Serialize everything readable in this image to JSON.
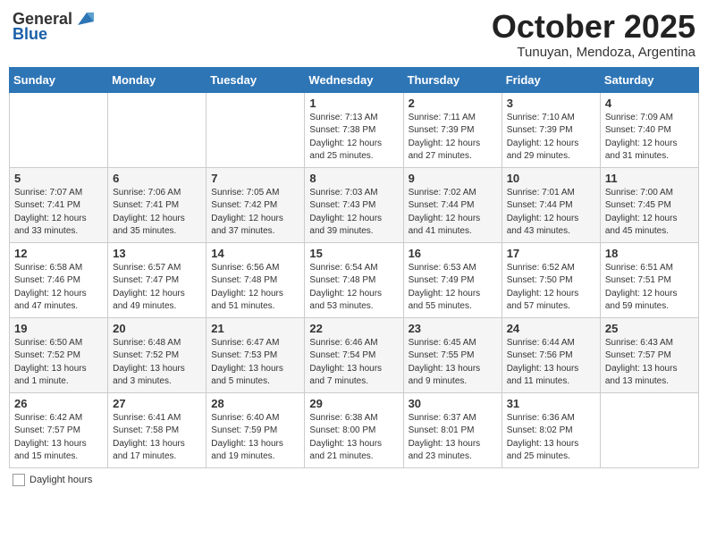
{
  "logo": {
    "general": "General",
    "blue": "Blue"
  },
  "header": {
    "month": "October 2025",
    "location": "Tunuyan, Mendoza, Argentina"
  },
  "weekdays": [
    "Sunday",
    "Monday",
    "Tuesday",
    "Wednesday",
    "Thursday",
    "Friday",
    "Saturday"
  ],
  "weeks": [
    [
      {
        "day": "",
        "info": ""
      },
      {
        "day": "",
        "info": ""
      },
      {
        "day": "",
        "info": ""
      },
      {
        "day": "1",
        "info": "Sunrise: 7:13 AM\nSunset: 7:38 PM\nDaylight: 12 hours\nand 25 minutes."
      },
      {
        "day": "2",
        "info": "Sunrise: 7:11 AM\nSunset: 7:39 PM\nDaylight: 12 hours\nand 27 minutes."
      },
      {
        "day": "3",
        "info": "Sunrise: 7:10 AM\nSunset: 7:39 PM\nDaylight: 12 hours\nand 29 minutes."
      },
      {
        "day": "4",
        "info": "Sunrise: 7:09 AM\nSunset: 7:40 PM\nDaylight: 12 hours\nand 31 minutes."
      }
    ],
    [
      {
        "day": "5",
        "info": "Sunrise: 7:07 AM\nSunset: 7:41 PM\nDaylight: 12 hours\nand 33 minutes."
      },
      {
        "day": "6",
        "info": "Sunrise: 7:06 AM\nSunset: 7:41 PM\nDaylight: 12 hours\nand 35 minutes."
      },
      {
        "day": "7",
        "info": "Sunrise: 7:05 AM\nSunset: 7:42 PM\nDaylight: 12 hours\nand 37 minutes."
      },
      {
        "day": "8",
        "info": "Sunrise: 7:03 AM\nSunset: 7:43 PM\nDaylight: 12 hours\nand 39 minutes."
      },
      {
        "day": "9",
        "info": "Sunrise: 7:02 AM\nSunset: 7:44 PM\nDaylight: 12 hours\nand 41 minutes."
      },
      {
        "day": "10",
        "info": "Sunrise: 7:01 AM\nSunset: 7:44 PM\nDaylight: 12 hours\nand 43 minutes."
      },
      {
        "day": "11",
        "info": "Sunrise: 7:00 AM\nSunset: 7:45 PM\nDaylight: 12 hours\nand 45 minutes."
      }
    ],
    [
      {
        "day": "12",
        "info": "Sunrise: 6:58 AM\nSunset: 7:46 PM\nDaylight: 12 hours\nand 47 minutes."
      },
      {
        "day": "13",
        "info": "Sunrise: 6:57 AM\nSunset: 7:47 PM\nDaylight: 12 hours\nand 49 minutes."
      },
      {
        "day": "14",
        "info": "Sunrise: 6:56 AM\nSunset: 7:48 PM\nDaylight: 12 hours\nand 51 minutes."
      },
      {
        "day": "15",
        "info": "Sunrise: 6:54 AM\nSunset: 7:48 PM\nDaylight: 12 hours\nand 53 minutes."
      },
      {
        "day": "16",
        "info": "Sunrise: 6:53 AM\nSunset: 7:49 PM\nDaylight: 12 hours\nand 55 minutes."
      },
      {
        "day": "17",
        "info": "Sunrise: 6:52 AM\nSunset: 7:50 PM\nDaylight: 12 hours\nand 57 minutes."
      },
      {
        "day": "18",
        "info": "Sunrise: 6:51 AM\nSunset: 7:51 PM\nDaylight: 12 hours\nand 59 minutes."
      }
    ],
    [
      {
        "day": "19",
        "info": "Sunrise: 6:50 AM\nSunset: 7:52 PM\nDaylight: 13 hours\nand 1 minute."
      },
      {
        "day": "20",
        "info": "Sunrise: 6:48 AM\nSunset: 7:52 PM\nDaylight: 13 hours\nand 3 minutes."
      },
      {
        "day": "21",
        "info": "Sunrise: 6:47 AM\nSunset: 7:53 PM\nDaylight: 13 hours\nand 5 minutes."
      },
      {
        "day": "22",
        "info": "Sunrise: 6:46 AM\nSunset: 7:54 PM\nDaylight: 13 hours\nand 7 minutes."
      },
      {
        "day": "23",
        "info": "Sunrise: 6:45 AM\nSunset: 7:55 PM\nDaylight: 13 hours\nand 9 minutes."
      },
      {
        "day": "24",
        "info": "Sunrise: 6:44 AM\nSunset: 7:56 PM\nDaylight: 13 hours\nand 11 minutes."
      },
      {
        "day": "25",
        "info": "Sunrise: 6:43 AM\nSunset: 7:57 PM\nDaylight: 13 hours\nand 13 minutes."
      }
    ],
    [
      {
        "day": "26",
        "info": "Sunrise: 6:42 AM\nSunset: 7:57 PM\nDaylight: 13 hours\nand 15 minutes."
      },
      {
        "day": "27",
        "info": "Sunrise: 6:41 AM\nSunset: 7:58 PM\nDaylight: 13 hours\nand 17 minutes."
      },
      {
        "day": "28",
        "info": "Sunrise: 6:40 AM\nSunset: 7:59 PM\nDaylight: 13 hours\nand 19 minutes."
      },
      {
        "day": "29",
        "info": "Sunrise: 6:38 AM\nSunset: 8:00 PM\nDaylight: 13 hours\nand 21 minutes."
      },
      {
        "day": "30",
        "info": "Sunrise: 6:37 AM\nSunset: 8:01 PM\nDaylight: 13 hours\nand 23 minutes."
      },
      {
        "day": "31",
        "info": "Sunrise: 6:36 AM\nSunset: 8:02 PM\nDaylight: 13 hours\nand 25 minutes."
      },
      {
        "day": "",
        "info": ""
      }
    ]
  ],
  "footer": {
    "label": "Daylight hours"
  }
}
